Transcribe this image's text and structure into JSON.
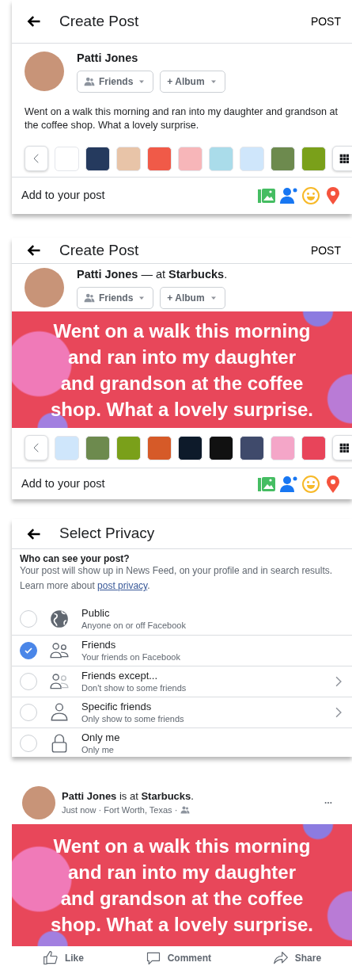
{
  "create_post_plain": {
    "header": {
      "title": "Create Post",
      "action": "POST"
    },
    "author": {
      "name": "Patti Jones",
      "audience": "Friends",
      "album": "+ Album"
    },
    "text": "Went on a walk this morning and ran into my daughter and grandson at the coffee shop. What a lovely surprise.",
    "backgrounds": [
      {
        "color": "#ffffff"
      },
      {
        "color": "#253a5e"
      },
      {
        "color": "#e8c4a8"
      },
      {
        "color": "#f05a48"
      },
      {
        "color": "#f7b6b9"
      },
      {
        "color": "#aadcea"
      },
      {
        "color": "#cfe6fb"
      },
      {
        "color": "#6d8a4e"
      },
      {
        "color": "#7aa01a"
      }
    ],
    "add_to_post": "Add to your post"
  },
  "create_post_background": {
    "header": {
      "title": "Create Post",
      "action": "POST"
    },
    "author": {
      "name": "**Patti Jones** — at **Starbucks**.",
      "audience": "Friends",
      "album": "+ Album"
    },
    "text": "Went on a walk this morning and ran into my daughter and grandson at the coffee shop. What a lovely surprise.",
    "backgrounds": [
      {
        "color": "#cfe6fb"
      },
      {
        "color": "#6d8a4e"
      },
      {
        "color": "#7aa01a"
      },
      {
        "color": "#d65a28"
      },
      {
        "color": "#0d1a2a"
      },
      {
        "color": "#111111"
      },
      {
        "color": "#3f4a6b"
      },
      {
        "color": "#f4a6c8"
      },
      {
        "color": "#e8445a"
      }
    ],
    "add_to_post": "Add to your post"
  },
  "select_privacy": {
    "header": {
      "title": "Select Privacy"
    },
    "question": "Who can see your post?",
    "description": "Your post will show up in News Feed, on your profile and in search results.",
    "learn_more": {
      "text": "Learn more about ",
      "link": "post privacy",
      "suffix": "."
    },
    "options": [
      {
        "kind": "globe",
        "label": "Public",
        "detail": "Anyone on or off Facebook",
        "selected": false,
        "has_submenu": false
      },
      {
        "kind": "friends",
        "label": "Friends",
        "detail": "Your friends on Facebook",
        "selected": true,
        "has_submenu": false
      },
      {
        "kind": "friends-except",
        "label": "Friends except...",
        "detail": "Don't show to some friends",
        "selected": false,
        "has_submenu": true
      },
      {
        "kind": "person",
        "label": "Specific friends",
        "detail": "Only show to some friends",
        "selected": false,
        "has_submenu": true
      },
      {
        "kind": "lock",
        "label": "Only me",
        "detail": "Only me",
        "selected": false,
        "has_submenu": false
      }
    ]
  },
  "published_post": {
    "author": "**Patti Jones** is at **Starbucks**.",
    "meta": "Just now · Fort Worth, Texas ·",
    "text": "Went on a walk this morning and ran into my daughter and grandson at the coffee shop. What a lovely surprise.",
    "actions": [
      {
        "kind": "like",
        "label": "Like"
      },
      {
        "kind": "comment",
        "label": "Comment"
      },
      {
        "kind": "share",
        "label": "Share"
      }
    ]
  }
}
